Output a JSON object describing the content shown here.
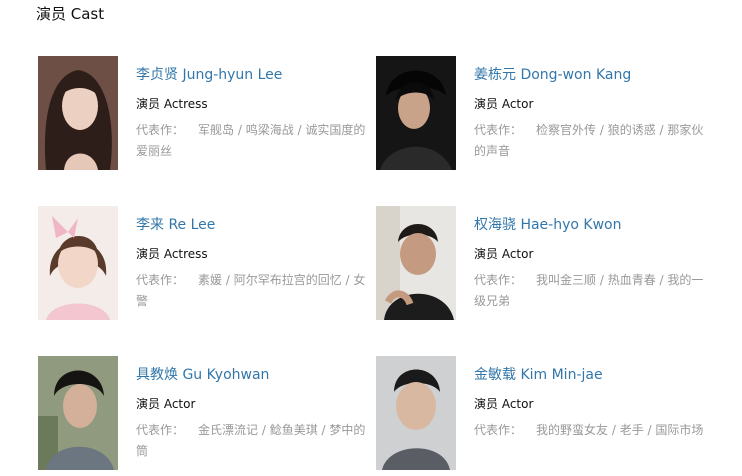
{
  "section": {
    "title": "演员 Cast"
  },
  "cast": [
    {
      "name": "李贞贤 Jung-hyun Lee",
      "role": "演员 Actress",
      "works_label": "代表作：",
      "works": "军舰岛 / 鸣梁海战 / 诚实国度的爱丽丝"
    },
    {
      "name": "姜栋元 Dong-won Kang",
      "role": "演员 Actor",
      "works_label": "代表作：",
      "works": "检察官外传 / 狼的诱惑 / 那家伙的声音"
    },
    {
      "name": "李来 Re Lee",
      "role": "演员 Actress",
      "works_label": "代表作：",
      "works": "素媛 / 阿尔罕布拉宫的回忆 / 女警"
    },
    {
      "name": "权海骁 Hae-hyo Kwon",
      "role": "演员 Actor",
      "works_label": "代表作：",
      "works": "我叫金三顺 / 热血青春 / 我的一级兄弟"
    },
    {
      "name": "具教焕 Gu Kyohwan",
      "role": "演员 Actor",
      "works_label": "代表作：",
      "works": "金氏漂流记 / 鲶鱼美琪 / 梦中的筒"
    },
    {
      "name": "金敏载 Kim Min-jae",
      "role": "演员 Actor",
      "works_label": "代表作：",
      "works": "我的野蛮女友 / 老手 / 国际市场"
    }
  ]
}
